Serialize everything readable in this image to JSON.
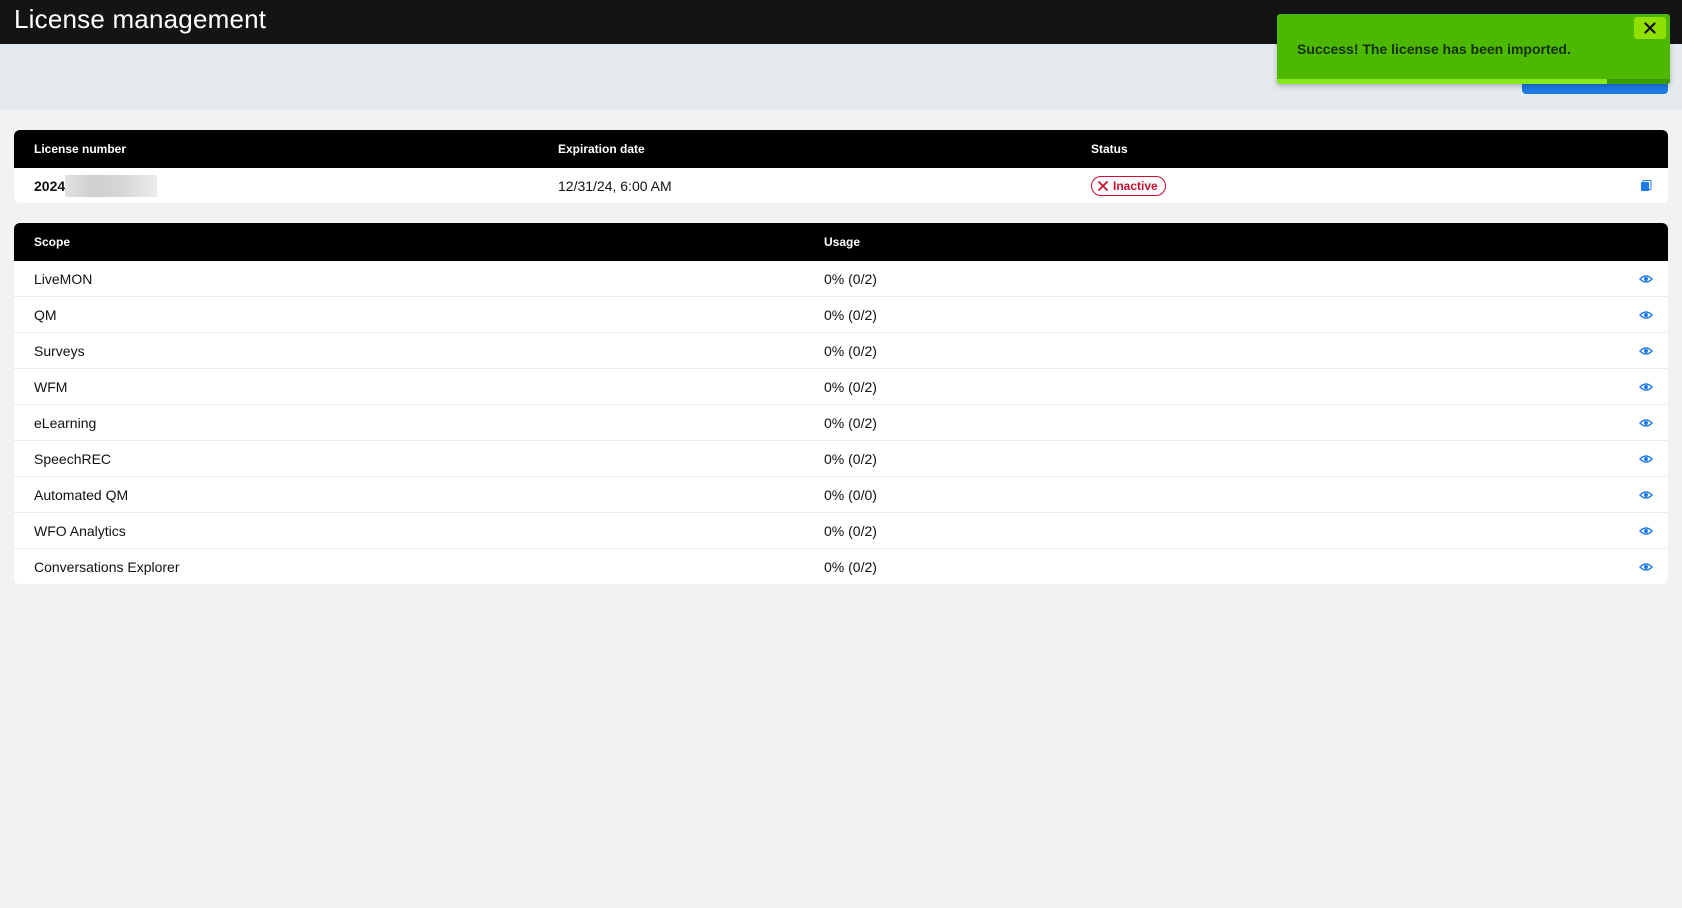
{
  "header": {
    "title": "License management"
  },
  "license_table": {
    "columns": [
      "License number",
      "Expiration date",
      "Status"
    ],
    "row": {
      "license_number": "2024",
      "expiration": "12/31/24, 6:00 AM",
      "status": "Inactive",
      "action_icon": "copy-icon"
    }
  },
  "scope_table": {
    "columns": [
      "Scope",
      "Usage"
    ],
    "rows": [
      {
        "scope": "LiveMON",
        "usage": "0% (0/2)"
      },
      {
        "scope": "QM",
        "usage": "0% (0/2)"
      },
      {
        "scope": "Surveys",
        "usage": "0% (0/2)"
      },
      {
        "scope": "WFM",
        "usage": "0% (0/2)"
      },
      {
        "scope": "eLearning",
        "usage": "0% (0/2)"
      },
      {
        "scope": "SpeechREC",
        "usage": "0% (0/2)"
      },
      {
        "scope": "Automated QM",
        "usage": "0% (0/0)"
      },
      {
        "scope": "WFO Analytics",
        "usage": "0% (0/2)"
      },
      {
        "scope": "Conversations Explorer",
        "usage": "0% (0/2)"
      }
    ],
    "action_icon": "eye-icon"
  },
  "toast": {
    "message": "Success! The license has been imported.",
    "close_icon": "close-icon",
    "progress": 0.84
  },
  "colors": {
    "accent": "#1e7be5",
    "toast_bg": "#4cb800",
    "status_inactive": "#c8102e",
    "header_bg": "#000000"
  }
}
